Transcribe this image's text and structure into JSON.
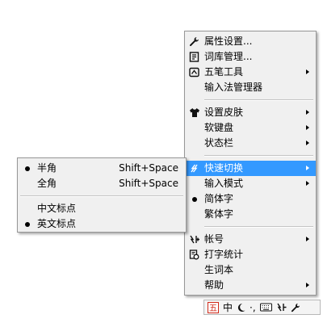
{
  "main_menu": {
    "group1": [
      {
        "label": "属性设置...",
        "icon": "wrench-icon",
        "submenu": false
      },
      {
        "label": "词库管理...",
        "icon": "dictionary-icon",
        "submenu": false
      },
      {
        "label": "五笔工具",
        "icon": "wubi-tool-icon",
        "submenu": true
      },
      {
        "label": "输入法管理器",
        "icon": "",
        "submenu": false
      }
    ],
    "group2": [
      {
        "label": "设置皮肤",
        "icon": "shirt-icon",
        "submenu": true
      },
      {
        "label": "软键盘",
        "icon": "",
        "submenu": true
      },
      {
        "label": "状态栏",
        "icon": "",
        "submenu": true
      }
    ],
    "group3": [
      {
        "label": "快速切换",
        "icon": "switch-icon",
        "submenu": true,
        "highlighted": true
      },
      {
        "label": "输入模式",
        "icon": "",
        "submenu": true
      },
      {
        "label": "简体字",
        "icon": "",
        "submenu": false,
        "checked": true
      },
      {
        "label": "繁体字",
        "icon": "",
        "submenu": false
      }
    ],
    "group4": [
      {
        "label": "帐号",
        "icon": "account-icon",
        "submenu": true
      },
      {
        "label": "打字统计",
        "icon": "stats-icon",
        "submenu": false
      },
      {
        "label": "生词本",
        "icon": "",
        "submenu": false
      },
      {
        "label": "帮助",
        "icon": "",
        "submenu": true
      }
    ]
  },
  "sub_menu": {
    "items": [
      {
        "label": "半角",
        "shortcut": "Shift+Space",
        "checked": true
      },
      {
        "label": "全角",
        "shortcut": "Shift+Space",
        "checked": false
      },
      {
        "label": "中文标点",
        "shortcut": "",
        "checked": false
      },
      {
        "label": "英文标点",
        "shortcut": "",
        "checked": true
      }
    ]
  },
  "status_bar": {
    "logo_char": "五",
    "mode_text": "中",
    "punct_text": "·,",
    "icons": [
      "wubi-logo-icon",
      "half-width-moon-icon",
      "punctuation-icon",
      "keyboard-icon",
      "switch-icon",
      "wrench-icon"
    ],
    "accent_color": "#d12a1a"
  },
  "colors": {
    "menu_bg": "#f0f0f0",
    "highlight": "#3399ff"
  }
}
